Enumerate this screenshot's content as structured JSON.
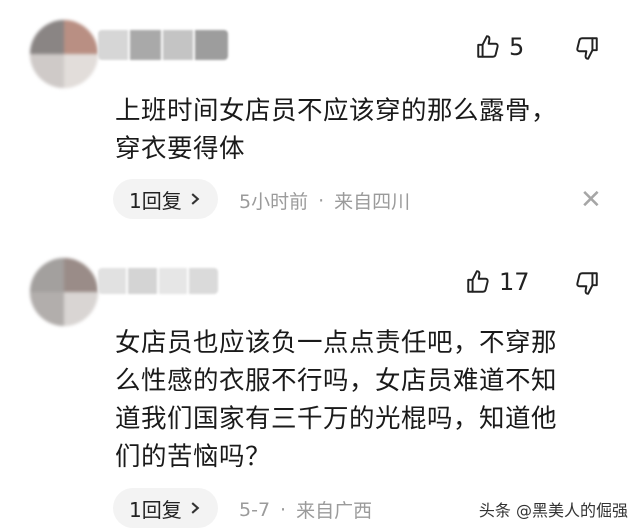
{
  "comments": [
    {
      "likes": "5",
      "text_lines": [
        "上班时间女店员不应该穿的那么露骨，",
        "穿衣要得体"
      ],
      "reply_label": "1回复",
      "time": "5小时前",
      "dot": "·",
      "location": "来自四川",
      "close": "✕"
    },
    {
      "likes": "17",
      "text_lines": [
        "女店员也应该负一点点责任吧，不穿那",
        "么性感的衣服不行吗，女店员难道不知",
        "道我们国家有三千万的光棍吗，知道他",
        "们的苦恼吗？"
      ],
      "reply_label": "1回复",
      "time": "5-7",
      "dot": "·",
      "location": "来自广西"
    }
  ],
  "watermark": "头条 @黑美人的倔强",
  "icons": {
    "like": "thumbs-up-icon",
    "dislike": "thumbs-down-icon",
    "chevron": "chevron-right-icon",
    "close": "close-icon"
  }
}
